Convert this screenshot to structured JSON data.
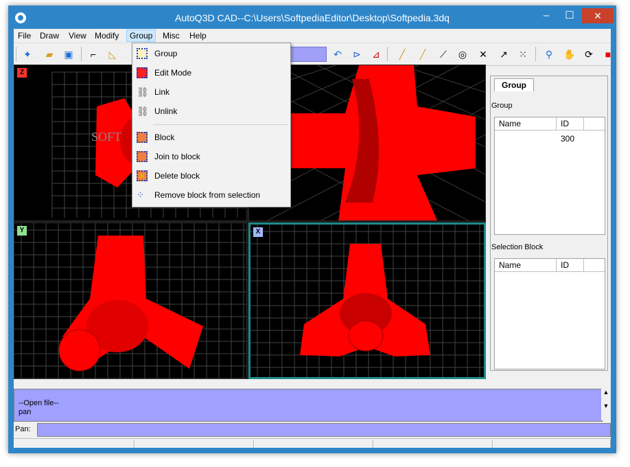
{
  "window": {
    "title": "AutoQ3D CAD--C:\\Users\\SoftpediaEditor\\Desktop\\Softpedia.3dq",
    "minimize": "–",
    "maximize": "☐",
    "close": "✕"
  },
  "menu": [
    {
      "id": "file",
      "label": "File"
    },
    {
      "id": "draw",
      "label": "Draw"
    },
    {
      "id": "view",
      "label": "View"
    },
    {
      "id": "modify",
      "label": "Modify"
    },
    {
      "id": "group",
      "label": "Group"
    },
    {
      "id": "misc",
      "label": "Misc"
    },
    {
      "id": "help",
      "label": "Help"
    }
  ],
  "group_menu": {
    "items": [
      {
        "label": "Group",
        "icon": "group-icon"
      },
      {
        "label": "Edit Mode",
        "icon": "edit-mode-icon"
      },
      {
        "label": "Link",
        "icon": "link-icon"
      },
      {
        "label": "Unlink",
        "icon": "unlink-icon"
      },
      {
        "label": "Block",
        "icon": "block-icon"
      },
      {
        "label": "Join to block",
        "icon": "join-block-icon"
      },
      {
        "label": "Delete block",
        "icon": "delete-block-icon"
      },
      {
        "label": "Remove block from selection",
        "icon": "remove-block-icon"
      }
    ]
  },
  "viewports": {
    "top_left_axis": "Z",
    "bottom_left_axis": "Y",
    "bottom_right_axis": "X",
    "watermark": "SOFT"
  },
  "right_panel": {
    "tab": "Group",
    "group_label": "Group",
    "group_cols": [
      "Name",
      "ID"
    ],
    "group_rows": [
      {
        "name": "",
        "id": "300"
      }
    ],
    "selection_label": "Selection Block",
    "selection_cols": [
      "Name",
      "ID"
    ]
  },
  "console": {
    "lines": [
      "--Open file--",
      "pan"
    ]
  },
  "command": {
    "label": "Pan:",
    "value": ""
  },
  "colors": {
    "titlebar": "#2e86c9",
    "console": "#a0a0ff",
    "object": "#ff0000",
    "active_viewport": "#1d8a8a"
  }
}
